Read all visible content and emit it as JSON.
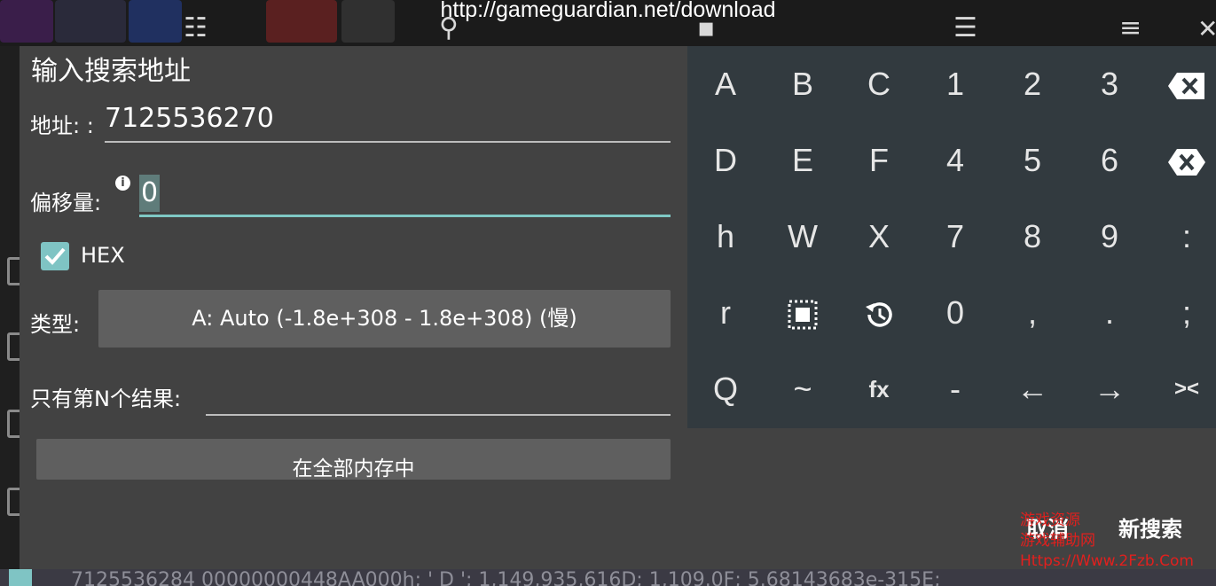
{
  "url_overlay": "http://gameguardian.net/download",
  "background_row": "7125536284    00000000448AA000h; ' D   '; 1,149,935,616D; 1,109.0F; 5.68143683e-315E;",
  "dialog": {
    "title": "输入搜索地址",
    "address_label": "地址: :",
    "address_value": "7125536270",
    "offset_label": "偏移量:",
    "offset_value": "0",
    "hex_label": "HEX",
    "hex_checked": true,
    "type_label": "类型:",
    "type_value": "A: Auto (-1.8e+308 - 1.8e+308) (慢)",
    "nth_label": "只有第N个结果:",
    "nth_value": "",
    "memory_button": "在全部内存中",
    "cancel_button": "取消",
    "new_search_button": "新搜索"
  },
  "keyboard": {
    "rows": [
      [
        "A",
        "B",
        "C",
        "1",
        "2",
        "3",
        "backspace-icon"
      ],
      [
        "D",
        "E",
        "F",
        "4",
        "5",
        "6",
        "clear-icon"
      ],
      [
        "h",
        "W",
        "X",
        "7",
        "8",
        "9",
        ":"
      ],
      [
        "r",
        "select-icon",
        "history-icon",
        "0",
        ",",
        ".",
        ";"
      ],
      [
        "Q",
        "~",
        "fx",
        "-",
        "←",
        "→",
        "><"
      ]
    ]
  },
  "watermark": [
    "游戏资源",
    "游戏辅助网",
    "Https://Www.2Fzb.Com"
  ],
  "colors": {
    "dialog_bg": "#424242",
    "keyboard_bg": "#323a3f",
    "accent": "#7fc4c4",
    "button_bg": "#5f5f5f",
    "watermark": "#e0201e"
  }
}
